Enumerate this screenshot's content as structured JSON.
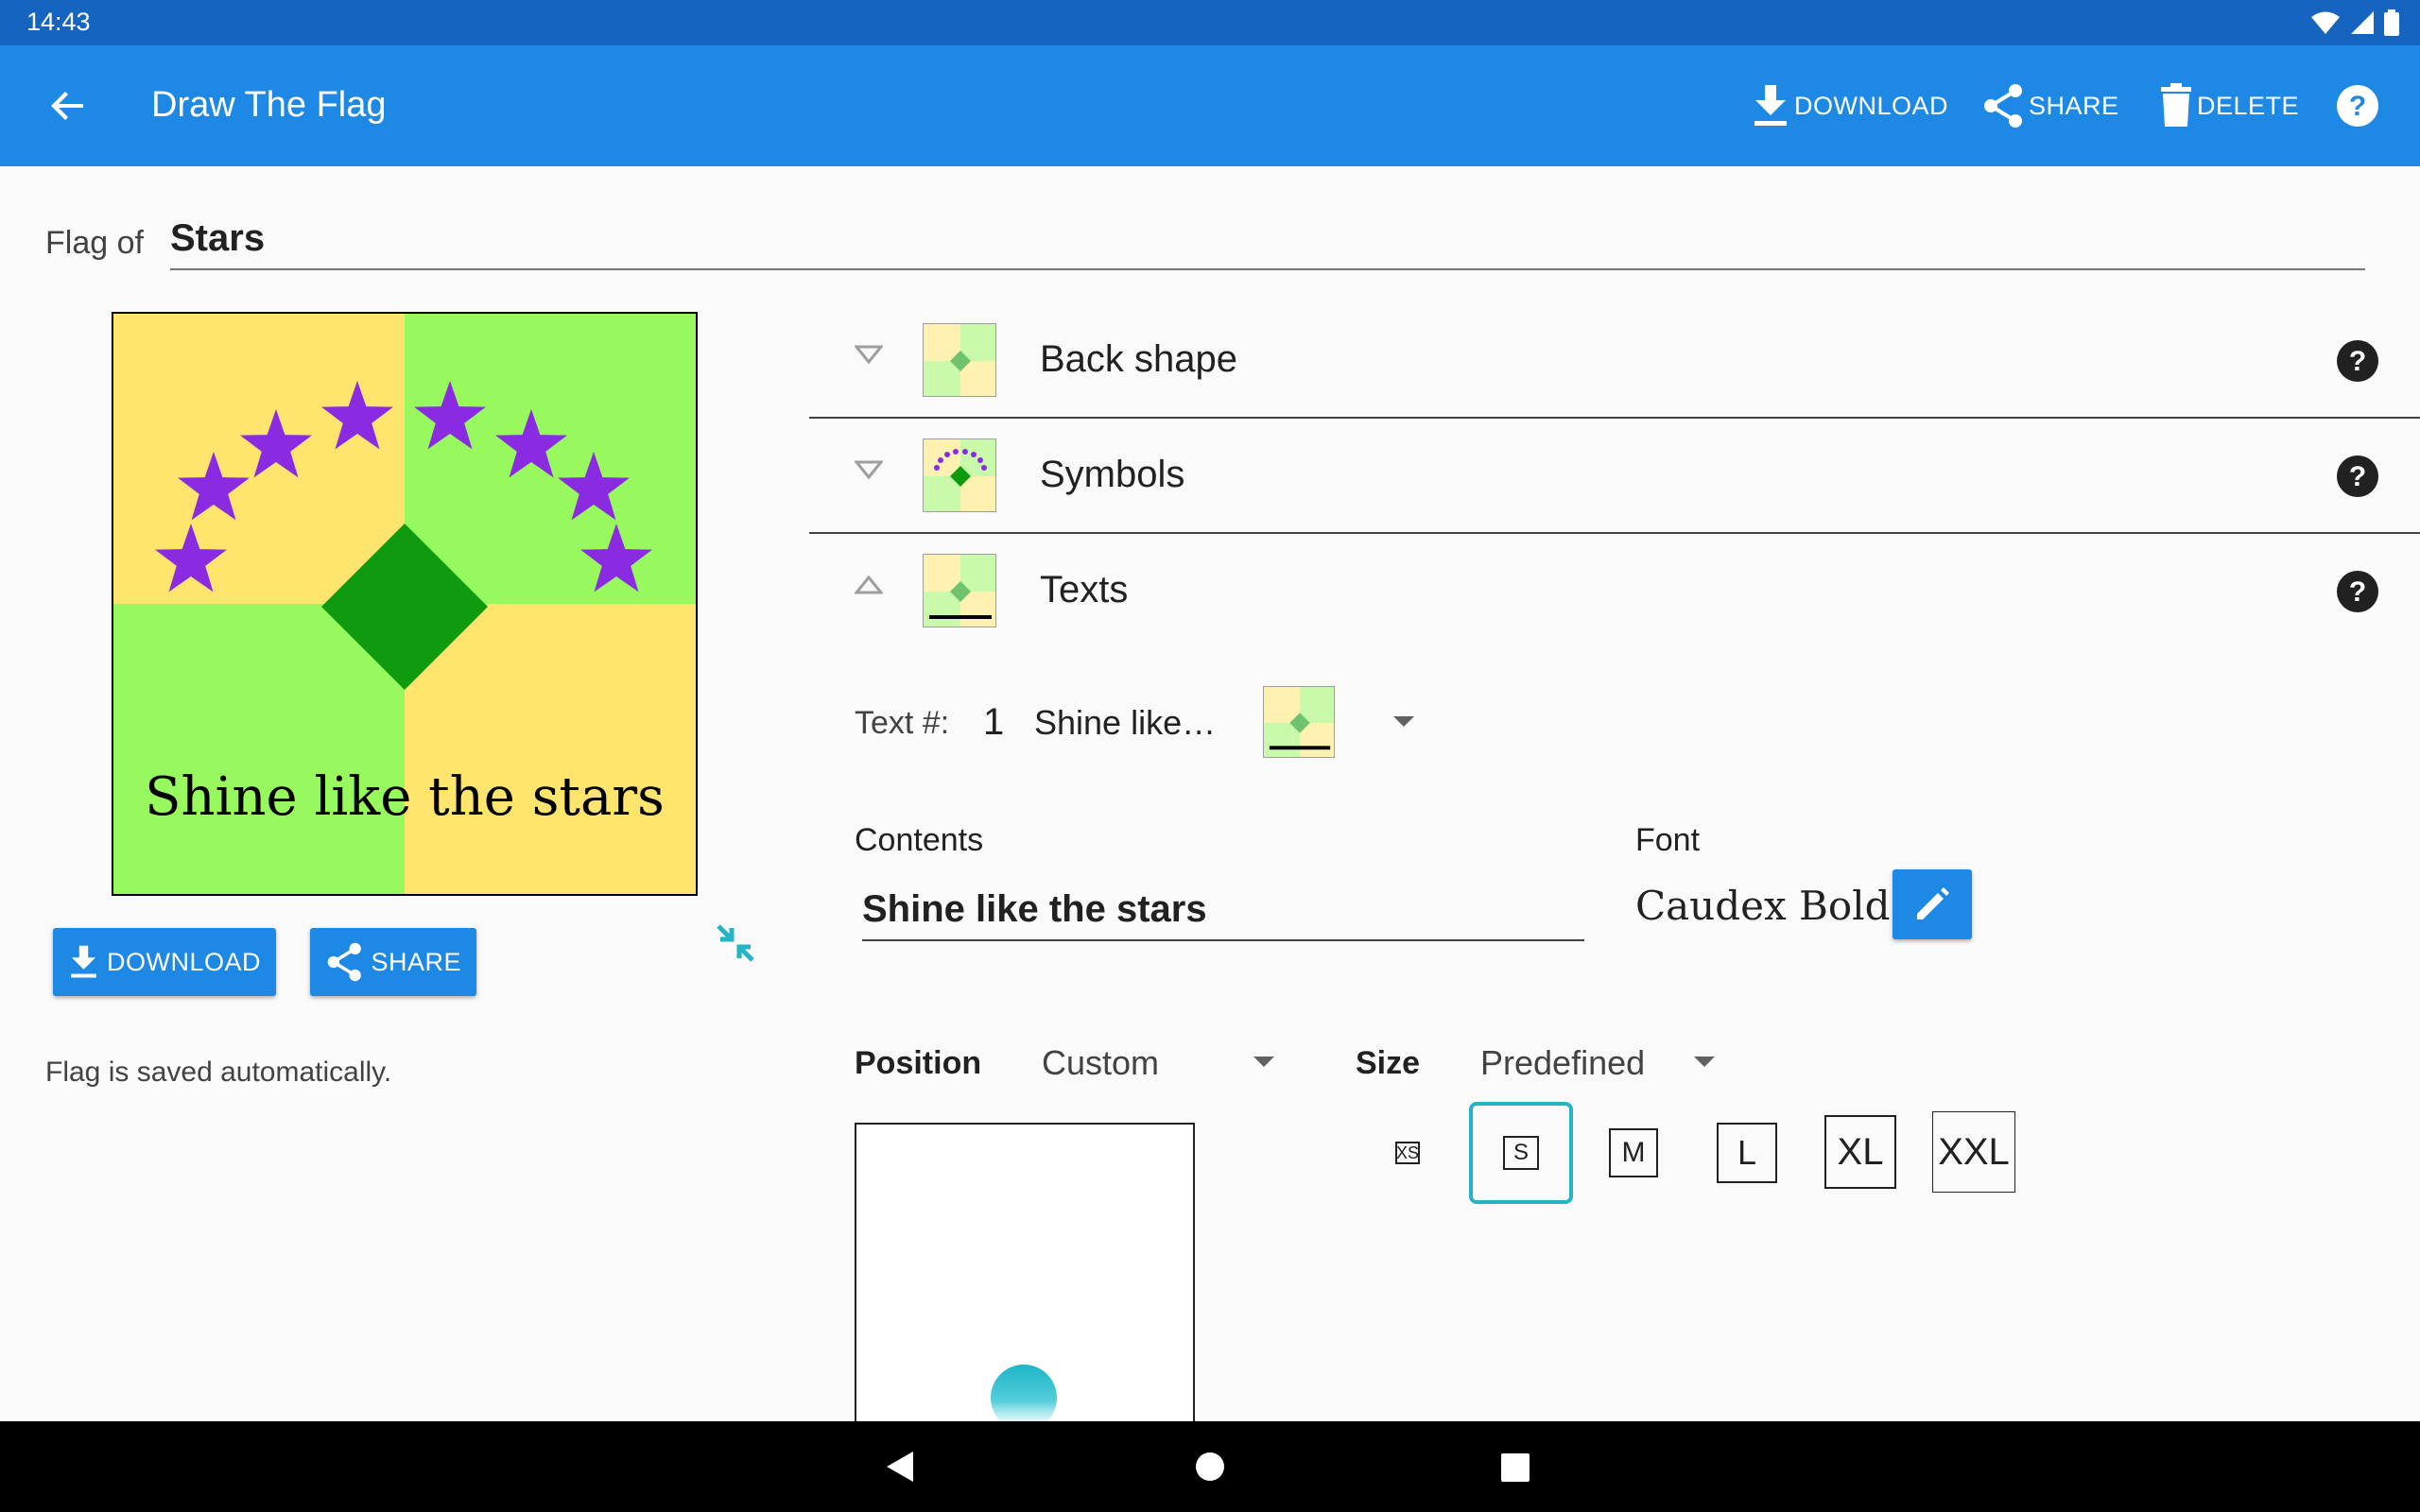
{
  "status_bar": {
    "time": "14:43"
  },
  "app_bar": {
    "title": "Draw The Flag",
    "download_label": "DOWNLOAD",
    "share_label": "SHARE",
    "delete_label": "DELETE"
  },
  "flag_name": {
    "label": "Flag of",
    "value": "Stars"
  },
  "flag_preview": {
    "text": "Shine like the stars",
    "colors": {
      "yellow": "#ffe46e",
      "green": "#98f95f",
      "diamond": "#0f9a0f",
      "stars": "#8a2be2"
    },
    "star_count": 8
  },
  "preview_actions": {
    "download_label": "DOWNLOAD",
    "share_label": "SHARE"
  },
  "saved_note": "Flag is saved automatically.",
  "sections": [
    {
      "label": "Back shape",
      "expanded": false
    },
    {
      "label": "Symbols",
      "expanded": false
    },
    {
      "label": "Texts",
      "expanded": true
    }
  ],
  "texts_panel": {
    "text_label": "Text #:",
    "text_number": "1",
    "text_selected": "Shine like…",
    "contents_label": "Contents",
    "contents_value": "Shine like the stars",
    "font_label": "Font",
    "font_value": "Caudex Bold",
    "position_label": "Position",
    "position_value": "Custom",
    "size_label": "Size",
    "size_value": "Predefined",
    "sizes": [
      "XS",
      "S",
      "M",
      "L",
      "XL",
      "XXL"
    ],
    "selected_size": "S"
  },
  "accent_color": "#1e88e5",
  "selection_color": "#26b3c4"
}
